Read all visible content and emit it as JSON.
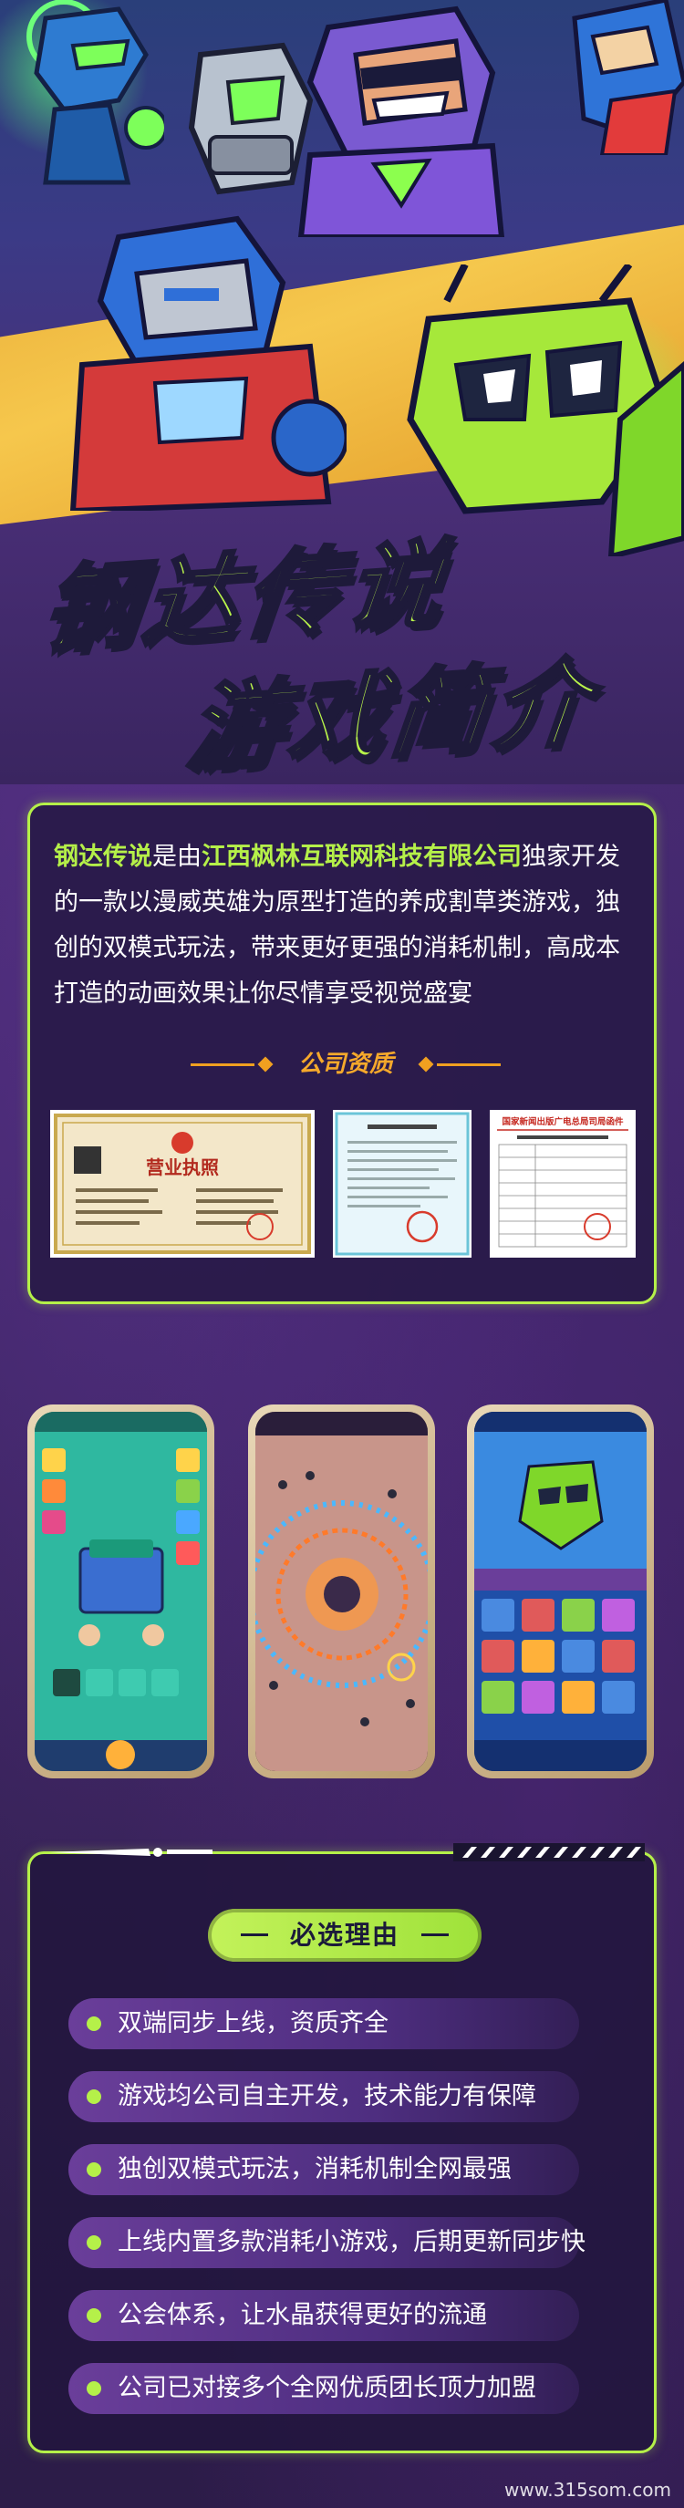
{
  "hero": {
    "title_line1": "钢达传说",
    "title_line2": "游戏简介"
  },
  "intro": {
    "text_pre": "",
    "game_name": "钢达传说",
    "text_mid1": "是由",
    "company": "江西枫林互联网科技有限公司",
    "text_rest": "独家开发的一款以漫威英雄为原型打造的养成割草类游戏，独创的双模式玩法，带来更好更强的消耗机制，高成本打造的动画效果让你尽情享受视觉盛宴",
    "section_label": "公司资质",
    "cert1_title": "营业执照",
    "cert3_title": "国家新闻出版广电总局司局函件"
  },
  "reasons": {
    "title": "必选理由",
    "items": [
      "双端同步上线，资质齐全",
      "游戏均公司自主开发，技术能力有保障",
      "独创双模式玩法，消耗机制全网最强",
      "上线内置多款消耗小游戏，后期更新同步快",
      "公会体系，让水晶获得更好的流通",
      "公司已对接多个全网优质团长顶力加盟"
    ]
  },
  "watermark": "www.315som.com",
  "colors": {
    "accent_green": "#b5f049",
    "accent_orange": "#f0a020",
    "bg_purple": "#3a2560"
  }
}
